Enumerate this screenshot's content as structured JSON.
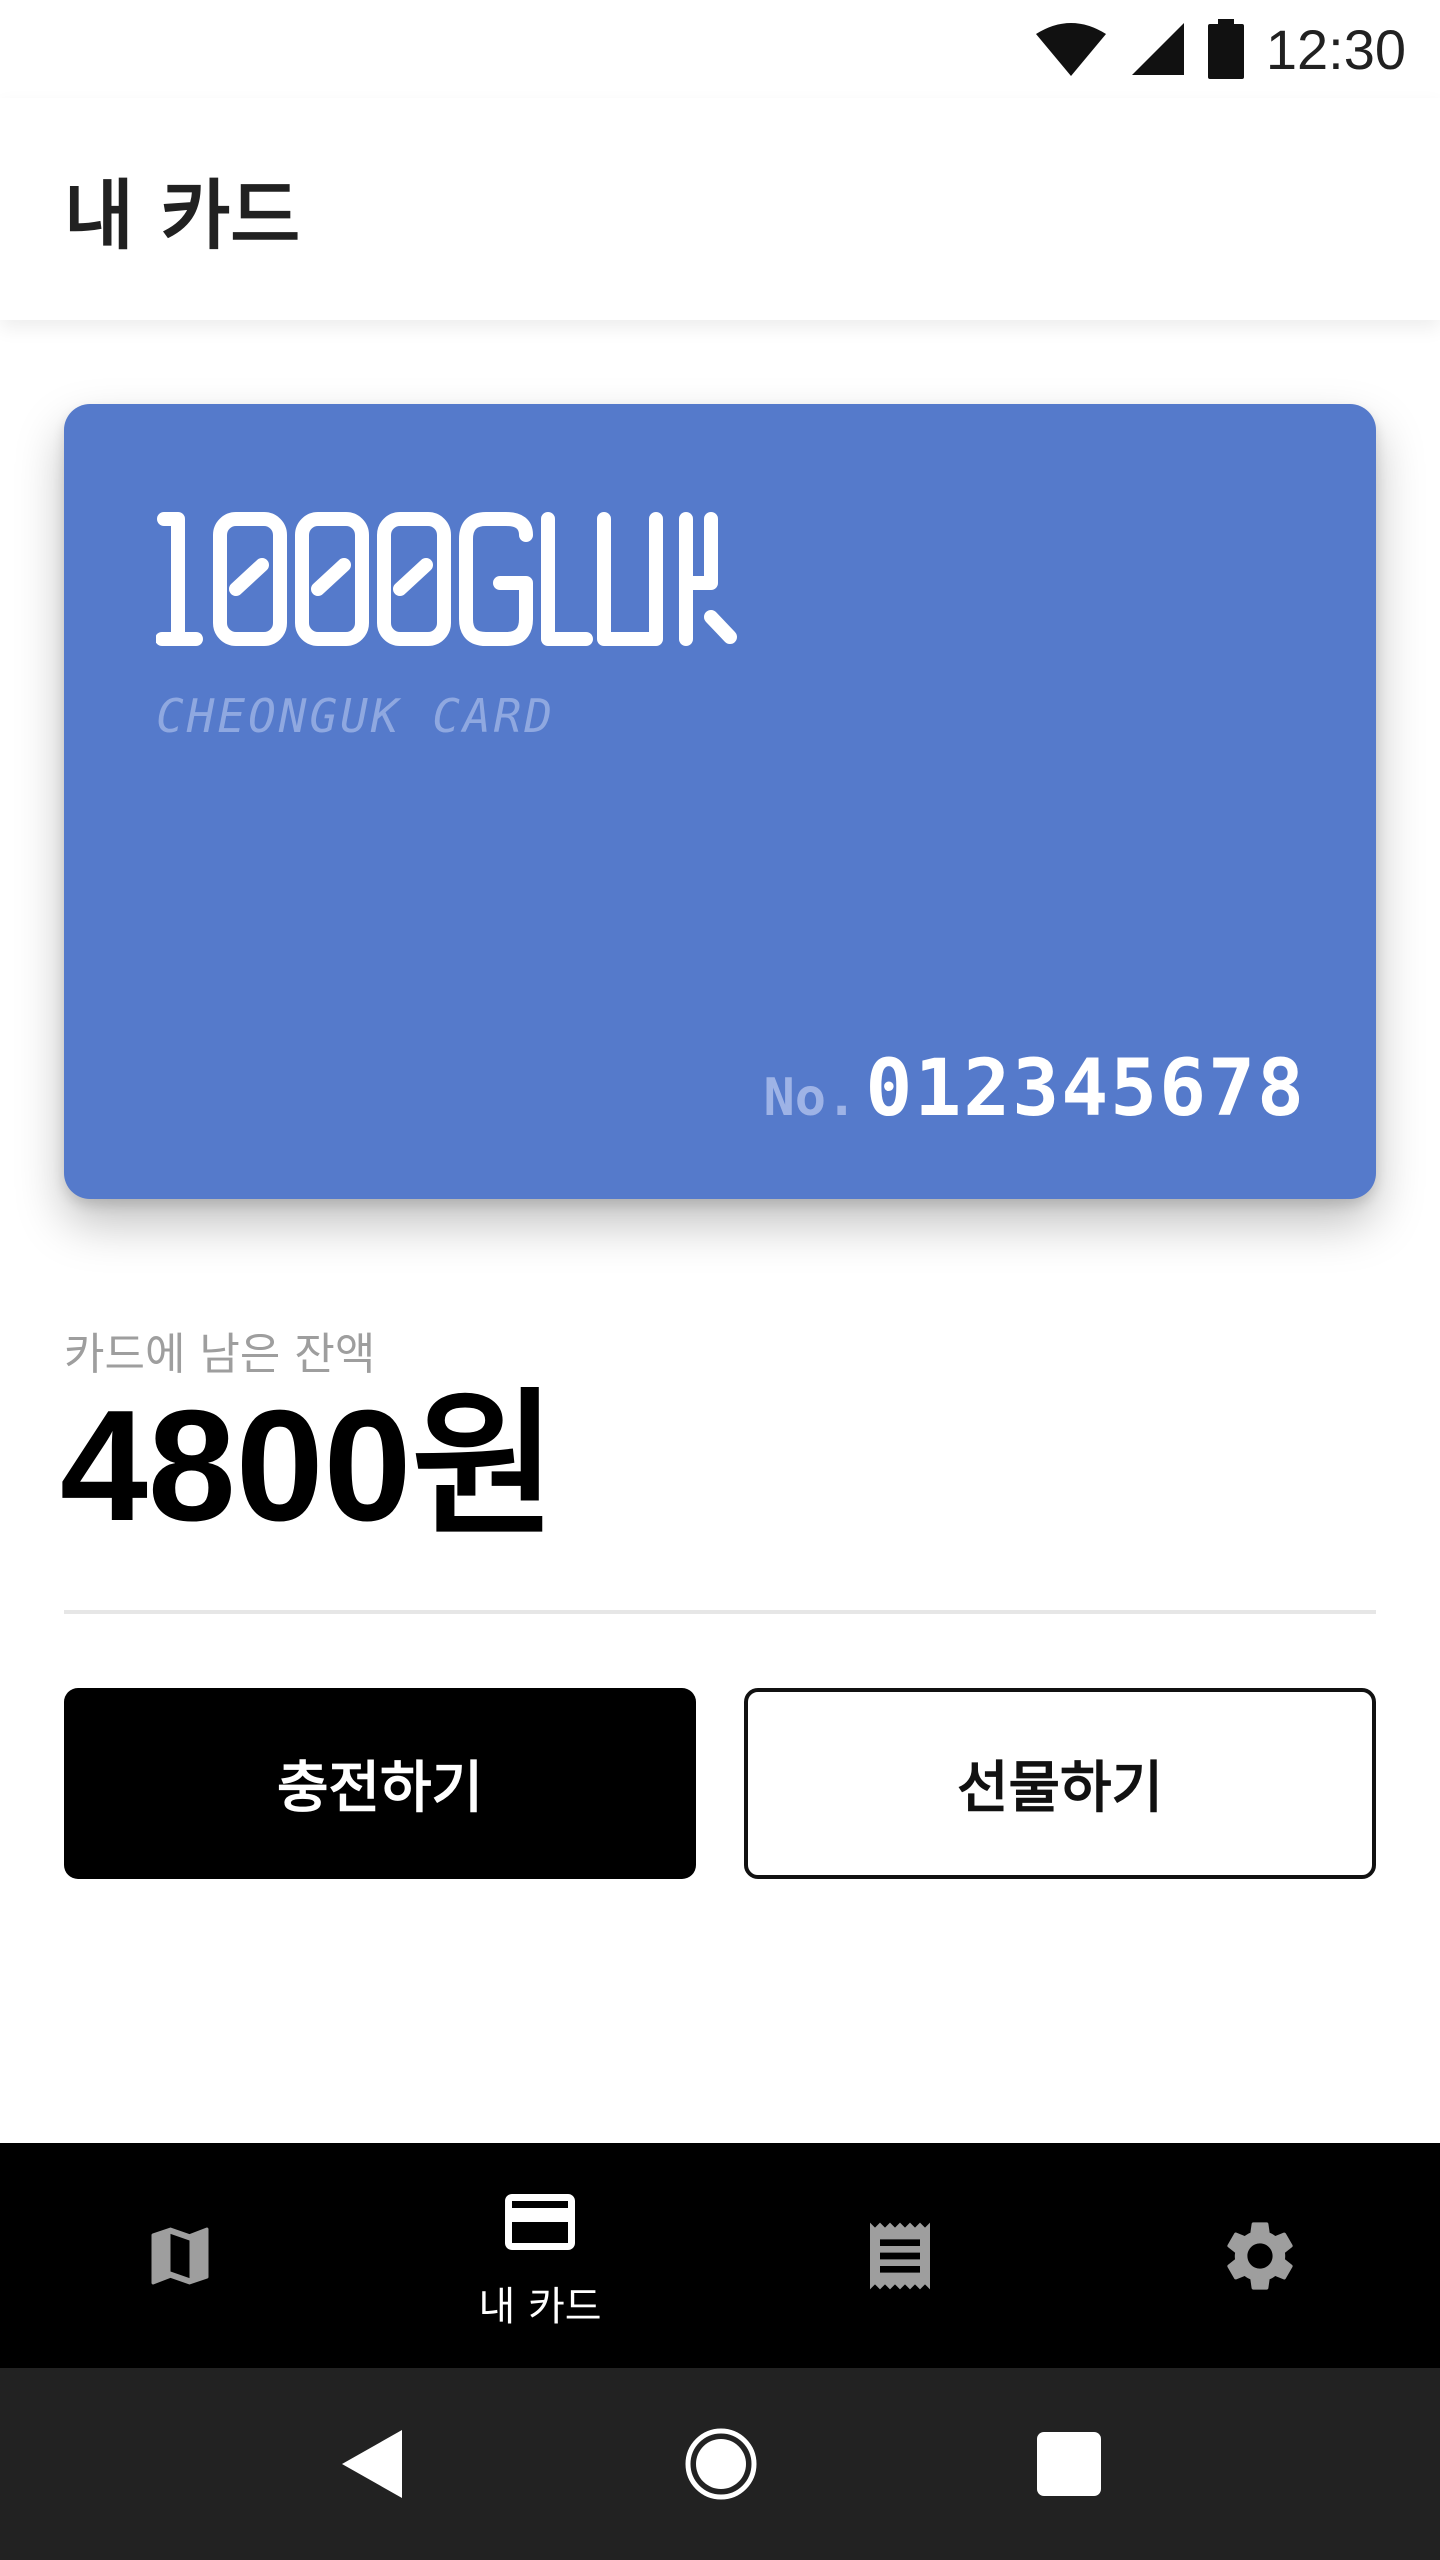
{
  "status_bar": {
    "time": "12:30",
    "icons": [
      "wifi-icon",
      "cellular-signal-icon",
      "battery-icon"
    ]
  },
  "app_bar": {
    "title": "내 카드"
  },
  "card": {
    "brand_logo_text": "1000GUK",
    "subtitle": "CHEONGUK CARD",
    "number_prefix": "No.",
    "number": "012345678",
    "background_color": "#557ACB"
  },
  "balance": {
    "label": "카드에 남은 잔액",
    "amount": "4800원"
  },
  "actions": {
    "charge_label": "충전하기",
    "gift_label": "선물하기"
  },
  "bottom_nav": {
    "items": [
      {
        "icon": "map-icon",
        "label": ""
      },
      {
        "icon": "credit-card-icon",
        "label": "내 카드",
        "selected": true
      },
      {
        "icon": "receipt-icon",
        "label": ""
      },
      {
        "icon": "settings-gear-icon",
        "label": ""
      }
    ],
    "active_color": "#FFFFFF",
    "inactive_color": "#9E9E9E"
  },
  "system_nav": {
    "icons": [
      "back-icon",
      "home-icon",
      "recents-icon"
    ]
  }
}
